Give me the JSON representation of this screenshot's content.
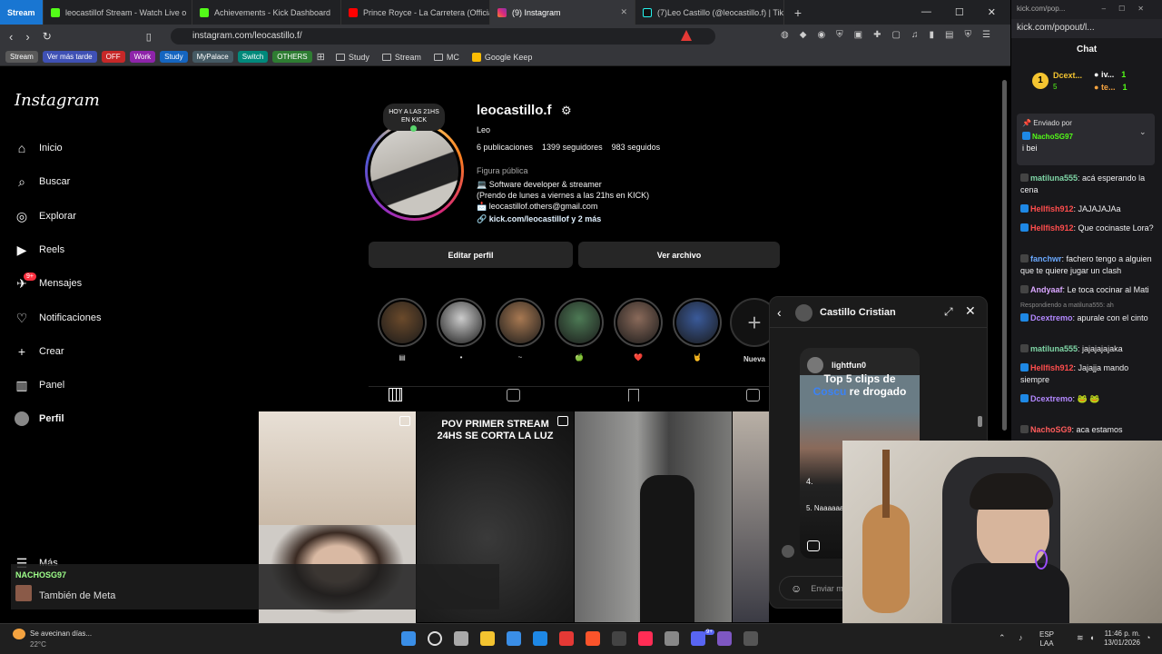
{
  "browser": {
    "tabs": [
      "Stream",
      "leocastillof Stream - Watch Live o",
      "Achievements - Kick Dashboard",
      "Prince Royce - La Carretera (Official V",
      "(9) Instagram",
      "(7)Leo Castillo (@leocastillo.f) | TikTo"
    ],
    "url": "instagram.com/leocastillo.f/",
    "bookmark_chips": [
      {
        "label": "Stream",
        "color": "#5a5a5a"
      },
      {
        "label": "Ver más tarde",
        "color": "#3f51b5"
      },
      {
        "label": "OFF",
        "color": "#c62828"
      },
      {
        "label": "Work",
        "color": "#8e24aa"
      },
      {
        "label": "Study",
        "color": "#1565c0"
      },
      {
        "label": "MyPalace",
        "color": "#455a64"
      },
      {
        "label": "Switch",
        "color": "#00897b"
      },
      {
        "label": "OTHERS",
        "color": "#2e7d32"
      }
    ],
    "bookmark_folders": [
      "Study",
      "Stream",
      "MC",
      "Google Keep"
    ]
  },
  "instagram": {
    "logo": "Instagram",
    "nav": [
      {
        "label": "Inicio",
        "icon": "home-icon",
        "glyph": "⌂"
      },
      {
        "label": "Buscar",
        "icon": "search-icon",
        "glyph": "⌕"
      },
      {
        "label": "Explorar",
        "icon": "compass-icon",
        "glyph": "◎"
      },
      {
        "label": "Reels",
        "icon": "reels-icon",
        "glyph": "▶"
      },
      {
        "label": "Mensajes",
        "icon": "messages-icon",
        "glyph": "✈"
      },
      {
        "label": "Notificaciones",
        "icon": "heart-icon",
        "glyph": "♡"
      },
      {
        "label": "Crear",
        "icon": "plus-icon",
        "glyph": "+"
      },
      {
        "label": "Panel",
        "icon": "chart-icon",
        "glyph": "▥"
      },
      {
        "label": "Perfil",
        "icon": "avatar-icon",
        "glyph": "●"
      }
    ],
    "messages_badge": "9+",
    "more": "Más",
    "note_bubble": "HOY A LAS 21HS EN KICK",
    "username": "leocastillo.f",
    "display_name": "Leo",
    "posts": "6 publicaciones",
    "followers": "1399 seguidores",
    "following": "983 seguidos",
    "category": "Figura pública",
    "bio": [
      "💻 Software developer & streamer",
      "(Prendo de lunes a viernes a las 21hs en KICK)",
      "📩 leocastillof.others@gmail.com"
    ],
    "link": "kick.com/leocastillof y 2 más",
    "edit_button": "Editar perfil",
    "archive_button": "Ver archivo",
    "highlights": [
      {
        "label": "▤",
        "color": "#6b4a2b"
      },
      {
        "label": "•",
        "color": "#ccc"
      },
      {
        "label": "~",
        "color": "#a87952"
      },
      {
        "label": "🍏",
        "color": "#4d7a55"
      },
      {
        "label": "❤️",
        "color": "#8a6a5a"
      },
      {
        "label": "🤘",
        "color": "#3a5a9a"
      }
    ],
    "new_highlight": "Nueva",
    "grid_post2_text": "POV PRIMER STREAM 24HS SE CORTA LA LUZ",
    "banner_user": "NACHOSG97",
    "banner_text": "También de Meta"
  },
  "dm": {
    "name": "Castillo Cristian",
    "shared_user": "lightfun0",
    "shared_title_1": "Top 5 clips de",
    "shared_title_2a": "Coscu",
    "shared_title_2b": " re drogado",
    "list": [
      "4.",
      "5. Naaaaaaa"
    ],
    "input_placeholder": "Enviar m"
  },
  "chat": {
    "url": "kick.com/pop...",
    "url2": "kick.com/popout/l...",
    "title": "Chat",
    "leader1": "Dcext...",
    "leader1_count": "5",
    "leader2": "iv...",
    "leader3": "te...",
    "leader_counts": [
      "1",
      "1"
    ],
    "pinned_label": "Enviado por",
    "pinned_user": "NachoSG97",
    "pinned_msg": "i bei",
    "reply_label": "Respondiendo a matiluna555: ah",
    "messages": [
      {
        "user": "matiluna555",
        "color": "#7fd6a6",
        "text": "acá esperando la cena"
      },
      {
        "user": "Hellfish912",
        "color": "#ff4d4d",
        "text": "JAJAJAJAa"
      },
      {
        "user": "Hellfish912",
        "color": "#ff4d4d",
        "text": "Que cocinaste Lora?"
      },
      {
        "user": "fanchwr",
        "color": "#6aa9ff",
        "text": "fachero tengo a alguien que te quiere jugar un clash"
      },
      {
        "user": "Andyaaf",
        "color": "#d9a6ff",
        "text": "Le toca cocinar al Mati"
      },
      {
        "user": "Dcextremo",
        "color": "#b388ff",
        "text": "apurale con el cinto"
      },
      {
        "user": "matiluna555",
        "color": "#7fd6a6",
        "text": "jajajajajaka"
      },
      {
        "user": "Hellfish912",
        "color": "#ff4d4d",
        "text": "Jajajja mando siempre"
      },
      {
        "user": "Dcextremo",
        "color": "#b388ff",
        "text": "🐸 🐸"
      },
      {
        "user": "NachoSG9",
        "color": "#ff5c5c",
        "text": "aca estamos"
      }
    ]
  },
  "taskbar": {
    "weather_title": "Se avecinan días...",
    "weather_temp": "22°C",
    "lang1": "ESP",
    "lang2": "LAA",
    "time": "11:46 p. m.",
    "date": "13/01/2026",
    "badge": "9+"
  }
}
